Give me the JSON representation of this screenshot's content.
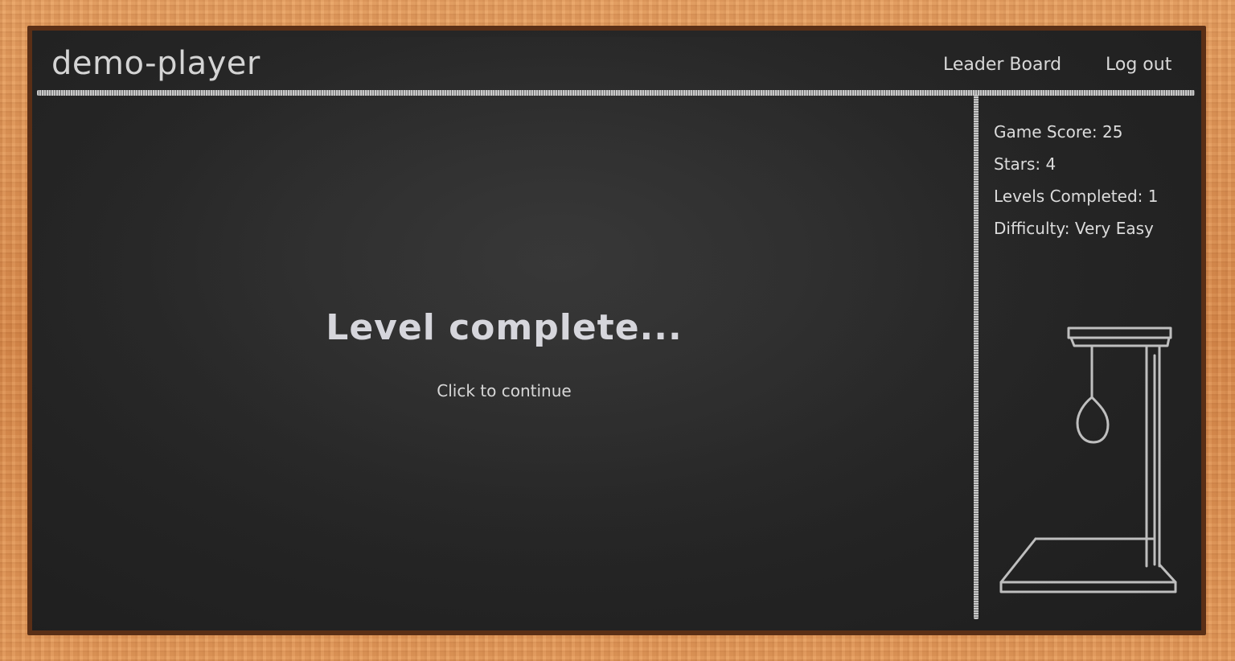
{
  "header": {
    "player_name": "demo-player",
    "nav": {
      "leader_board": "Leader Board",
      "log_out": "Log out"
    }
  },
  "stats": {
    "game_score": "Game Score: 25",
    "stars": "Stars: 4",
    "levels_completed": "Levels Completed: 1",
    "difficulty": "Difficulty: Very Easy"
  },
  "main": {
    "title": "Level complete...",
    "prompt": "Click to continue"
  },
  "icons": {
    "gallows": "gallows-icon"
  },
  "colors": {
    "chalkboard": "#262626",
    "chalk": "#d8d8d8",
    "frame_wood": "#d98a4c"
  }
}
